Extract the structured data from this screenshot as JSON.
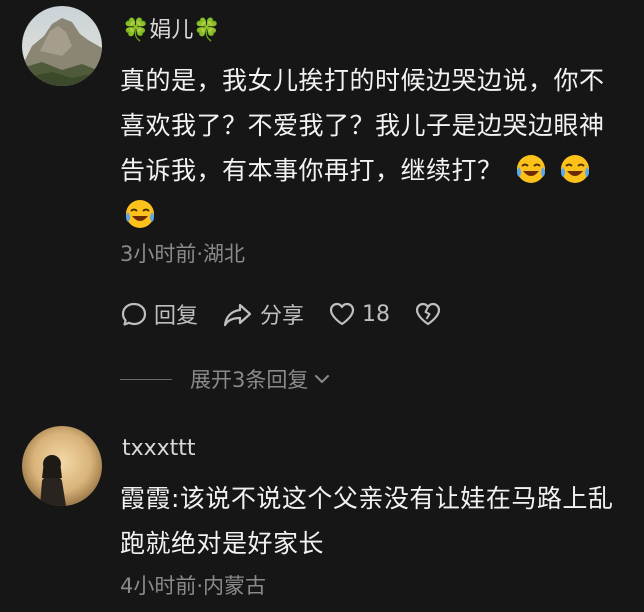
{
  "comments": [
    {
      "username": "娟儿",
      "username_decoration": "🍀",
      "text": "真的是，我女儿挨打的时候边哭边说，你不喜欢我了？不爱我了？我儿子是边哭边眼神告诉我，有本事你再打，继续打？",
      "emoji": "😂",
      "time_location": "3小时前·湖北",
      "reply_label": "回复",
      "share_label": "分享",
      "like_count": "18",
      "expand_label": "展开3条回复"
    },
    {
      "username": "txxxttt",
      "text": "霞霞:该说不说这个父亲没有让娃在马路上乱跑就绝对是好家长",
      "time_location": "4小时前·内蒙古"
    }
  ],
  "colors": {
    "background": "#161616",
    "text": "#f2f2f2",
    "meta": "#8a8a8a",
    "clover": "#3ec46d"
  }
}
